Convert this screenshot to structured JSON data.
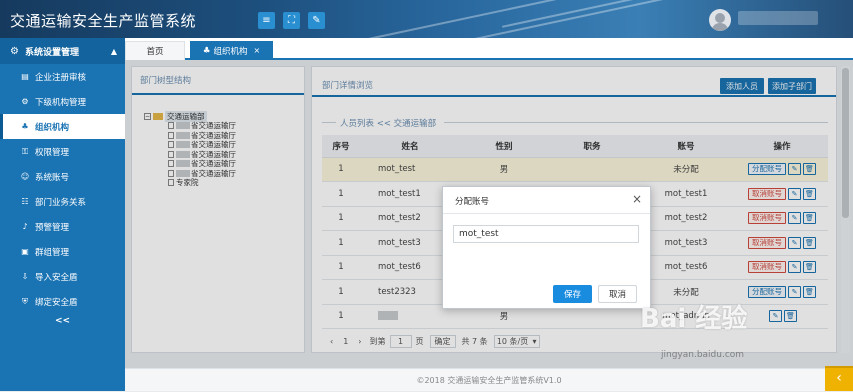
{
  "app": {
    "title": "交通运输安全生产监管系统"
  },
  "header": {
    "icons": [
      "menu-icon",
      "fullscreen-icon",
      "edit-icon"
    ]
  },
  "sidebar": {
    "section": "系统设置管理",
    "items": [
      {
        "label": "企业注册审核",
        "icon": "list-icon"
      },
      {
        "label": "下级机构管理",
        "icon": "gear-icon"
      },
      {
        "label": "组织机构",
        "icon": "org-icon",
        "active": true
      },
      {
        "label": "权限管理",
        "icon": "key-icon"
      },
      {
        "label": "系统账号",
        "icon": "user-icon"
      },
      {
        "label": "部门业务关系",
        "icon": "users-icon"
      },
      {
        "label": "预警管理",
        "icon": "bell-icon"
      },
      {
        "label": "群组管理",
        "icon": "group-icon"
      },
      {
        "label": "导入安全盾",
        "icon": "import-icon"
      },
      {
        "label": "绑定安全盾",
        "icon": "shield-icon"
      }
    ],
    "collapse": "<<"
  },
  "tabs": {
    "home": "首页",
    "current": "组织机构",
    "close": "×"
  },
  "left_panel": {
    "title": "部门树型结构",
    "root": "交通运输部",
    "children": [
      "省交通运输厅",
      "省交通运输厅",
      "省交通运输厅",
      "省交通运输厅",
      "省交通运输厅",
      "省交通运输厅"
    ],
    "last_child": "专家院"
  },
  "right_panel": {
    "title": "部门详情浏览",
    "add_person": "添加人员",
    "add_dept": "添加子部门",
    "section": "人员列表 << 交通运输部",
    "columns": [
      "序号",
      "姓名",
      "性别",
      "职务",
      "账号",
      "操作"
    ],
    "rows": [
      {
        "no": "1",
        "name": "mot_test",
        "gender": "男",
        "title": "",
        "account": "未分配",
        "action": "分配账号"
      },
      {
        "no": "1",
        "name": "mot_test1",
        "gender": "",
        "title": "",
        "account": "mot_test1",
        "action": "取消账号"
      },
      {
        "no": "1",
        "name": "mot_test2",
        "gender": "",
        "title": "",
        "account": "mot_test2",
        "action": "取消账号"
      },
      {
        "no": "1",
        "name": "mot_test3",
        "gender": "",
        "title": "",
        "account": "mot_test3",
        "action": "取消账号"
      },
      {
        "no": "1",
        "name": "mot_test6",
        "gender": "",
        "title": "",
        "account": "mot_test6",
        "action": "取消账号"
      },
      {
        "no": "1",
        "name": "test2323",
        "gender": "",
        "title": "",
        "account": "未分配",
        "action": "分配账号"
      },
      {
        "no": "1",
        "name": "",
        "gender": "男",
        "title": "",
        "account": "mot_admin",
        "action": ""
      }
    ],
    "pager": {
      "page": "1",
      "goto": "到第",
      "page_unit": "页",
      "confirm": "确定",
      "total": "共 7 条",
      "size": "10 条/页"
    }
  },
  "modal": {
    "title": "分配账号",
    "input_value": "mot_test",
    "save": "保存",
    "cancel": "取消"
  },
  "footer": "©2018 交通运输安全生产监管系统V1.0",
  "watermark": {
    "brand": "Bai 经验",
    "url": "jingyan.baidu.com"
  }
}
